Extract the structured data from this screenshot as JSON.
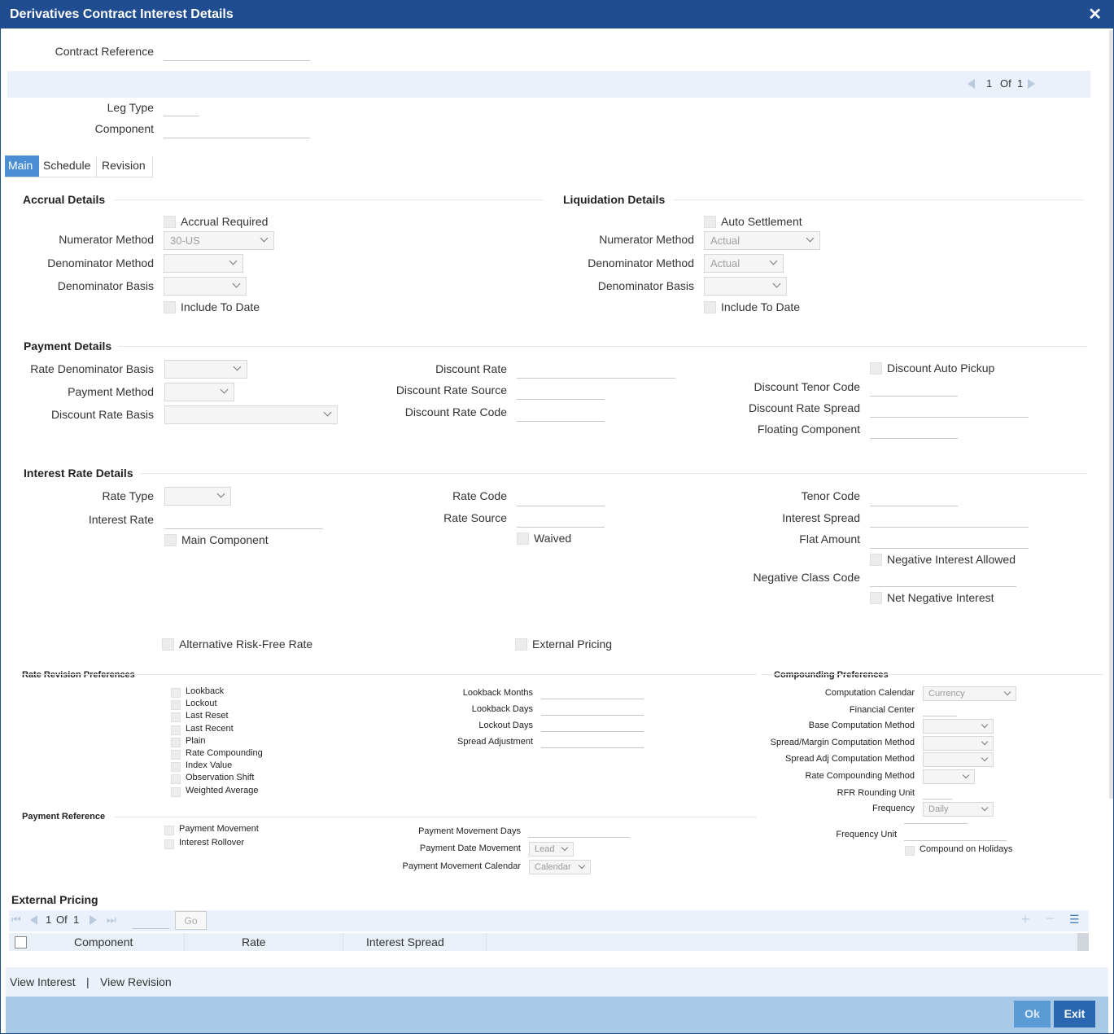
{
  "window": {
    "title": "Derivatives Contract Interest Details",
    "close_icon": "close-icon"
  },
  "header": {
    "contract_reference_label": "Contract Reference",
    "leg_type_label": "Leg Type",
    "component_label": "Component"
  },
  "pager": {
    "current": "1",
    "of": "Of",
    "total": "1"
  },
  "tabs": [
    {
      "label": "Main"
    },
    {
      "label": "Schedule"
    },
    {
      "label": "Revision"
    }
  ],
  "accrual": {
    "title": "Accrual Details",
    "accrual_required": "Accrual Required",
    "numerator_method_label": "Numerator Method",
    "numerator_method_value": "30-US",
    "denominator_method_label": "Denominator Method",
    "denominator_basis_label": "Denominator Basis",
    "include_to_date": "Include To Date"
  },
  "liquidation": {
    "title": "Liquidation Details",
    "auto_settlement": "Auto Settlement",
    "numerator_method_label": "Numerator Method",
    "numerator_method_value": "Actual",
    "denominator_method_label": "Denominator Method",
    "denominator_method_value": "Actual",
    "denominator_basis_label": "Denominator Basis",
    "include_to_date": "Include To Date"
  },
  "payment": {
    "title": "Payment Details",
    "rate_denominator_basis": "Rate Denominator Basis",
    "payment_method": "Payment Method",
    "discount_rate_basis": "Discount Rate Basis",
    "discount_rate": "Discount Rate",
    "discount_rate_source": "Discount Rate Source",
    "discount_rate_code": "Discount Rate Code",
    "discount_auto_pickup": "Discount Auto Pickup",
    "discount_tenor_code": "Discount Tenor Code",
    "discount_rate_spread": "Discount Rate Spread",
    "floating_component": "Floating Component"
  },
  "interest": {
    "title": "Interest Rate Details",
    "rate_type": "Rate Type",
    "interest_rate": "Interest Rate",
    "main_component": "Main Component",
    "rate_code": "Rate Code",
    "rate_source": "Rate Source",
    "waived": "Waived",
    "tenor_code": "Tenor Code",
    "interest_spread": "Interest Spread",
    "flat_amount": "Flat Amount",
    "negative_interest_allowed": "Negative Interest Allowed",
    "negative_class_code": "Negative Class Code",
    "net_negative_interest": "Net Negative Interest",
    "alternative_rfr": "Alternative Risk-Free Rate",
    "external_pricing": "External Pricing"
  },
  "rate_revision": {
    "title": "Rate Revision Preferences",
    "options": [
      "Lookback",
      "Lockout",
      "Last Reset",
      "Last Recent",
      "Plain",
      "Rate Compounding",
      "Index Value",
      "Observation Shift",
      "Weighted Average"
    ],
    "lookback_months": "Lookback Months",
    "lookback_days": "Lookback Days",
    "lockout_days": "Lockout Days",
    "spread_adjustment": "Spread Adjustment"
  },
  "compounding": {
    "title": "Compounding Preferences",
    "computation_calendar": "Computation Calendar",
    "computation_calendar_value": "Currency",
    "financial_center": "Financial Center",
    "base_computation_method": "Base Computation Method",
    "spread_margin_method": "Spread/Margin Computation Method",
    "spread_adj_method": "Spread Adj Computation Method",
    "rate_compounding_method": "Rate Compounding Method",
    "rfr_rounding_unit": "RFR Rounding Unit",
    "frequency": "Frequency",
    "frequency_value": "Daily",
    "frequency_unit": "Frequency Unit",
    "compound_on_holidays": "Compound on Holidays"
  },
  "payment_reference": {
    "title": "Payment Reference",
    "payment_movement": "Payment Movement",
    "interest_rollover": "Interest Rollover",
    "payment_movement_days": "Payment Movement Days",
    "payment_date_movement": "Payment Date Movement",
    "payment_date_movement_value": "Lead",
    "payment_movement_calendar": "Payment Movement Calendar",
    "payment_movement_calendar_value": "Calendar"
  },
  "external_pricing": {
    "title": "External Pricing",
    "pager_current": "1",
    "pager_of": "Of",
    "pager_total": "1",
    "go_label": "Go",
    "columns": [
      "Component",
      "Rate",
      "Interest Spread"
    ]
  },
  "footer": {
    "view_interest": "View Interest",
    "separator": "|",
    "view_revision": "View Revision"
  },
  "buttons": {
    "ok": "Ok",
    "exit": "Exit"
  }
}
